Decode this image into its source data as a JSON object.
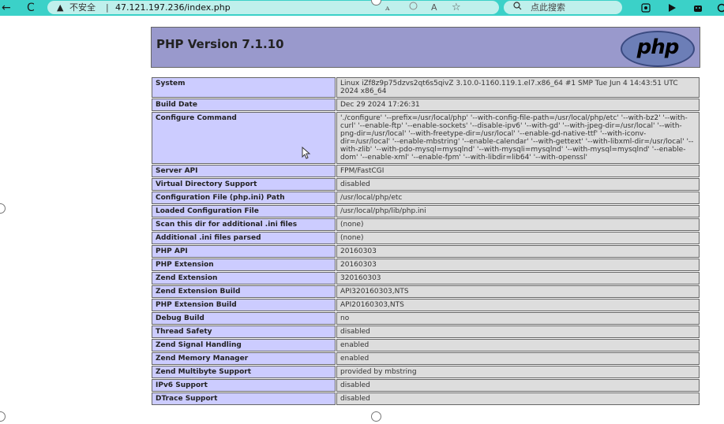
{
  "browser": {
    "back_glyph": "←",
    "reload_glyph": "C",
    "warning_glyph": "▲",
    "security_label": "不安全",
    "separator": "|",
    "url": "47.121.197.236/index.php",
    "read_aloud": "ꭺ",
    "immersive_glyph": "A",
    "favorite_glyph": "☆",
    "search_placeholder": "点此搜索",
    "tool_icons": [
      "screenshot-icon",
      "play-icon",
      "extension-icon"
    ]
  },
  "phpinfo": {
    "title": "PHP Version 7.1.10",
    "logo_text": "php",
    "rows": [
      {
        "key": "System",
        "value": "Linux iZf8z9p75dzvs2qt6s5qivZ 3.10.0-1160.119.1.el7.x86_64 #1 SMP Tue Jun 4 14:43:51 UTC 2024 x86_64"
      },
      {
        "key": "Build Date",
        "value": "Dec 29 2024 17:26:31"
      },
      {
        "key": "Configure Command",
        "value": "'./configure' '--prefix=/usr/local/php' '--with-config-file-path=/usr/local/php/etc' '--with-bz2' '--with-curl' '--enable-ftp' '--enable-sockets' '--disable-ipv6' '--with-gd' '--with-jpeg-dir=/usr/local' '--with-png-dir=/usr/local' '--with-freetype-dir=/usr/local' '--enable-gd-native-ttf' '--with-iconv-dir=/usr/local' '--enable-mbstring' '--enable-calendar' '--with-gettext' '--with-libxml-dir=/usr/local' '--with-zlib' '--with-pdo-mysql=mysqlnd' '--with-mysqli=mysqlnd' '--with-mysql=mysqlnd' '--enable-dom' '--enable-xml' '--enable-fpm' '--with-libdir=lib64' '--with-openssl'"
      },
      {
        "key": "Server API",
        "value": "FPM/FastCGI"
      },
      {
        "key": "Virtual Directory Support",
        "value": "disabled"
      },
      {
        "key": "Configuration File (php.ini) Path",
        "value": "/usr/local/php/etc"
      },
      {
        "key": "Loaded Configuration File",
        "value": "/usr/local/php/lib/php.ini"
      },
      {
        "key": "Scan this dir for additional .ini files",
        "value": "(none)"
      },
      {
        "key": "Additional .ini files parsed",
        "value": "(none)"
      },
      {
        "key": "PHP API",
        "value": "20160303"
      },
      {
        "key": "PHP Extension",
        "value": "20160303"
      },
      {
        "key": "Zend Extension",
        "value": "320160303"
      },
      {
        "key": "Zend Extension Build",
        "value": "API320160303,NTS"
      },
      {
        "key": "PHP Extension Build",
        "value": "API20160303,NTS"
      },
      {
        "key": "Debug Build",
        "value": "no"
      },
      {
        "key": "Thread Safety",
        "value": "disabled"
      },
      {
        "key": "Zend Signal Handling",
        "value": "enabled"
      },
      {
        "key": "Zend Memory Manager",
        "value": "enabled"
      },
      {
        "key": "Zend Multibyte Support",
        "value": "provided by mbstring"
      },
      {
        "key": "IPv6 Support",
        "value": "disabled"
      },
      {
        "key": "DTrace Support",
        "value": "disabled"
      }
    ]
  },
  "colors": {
    "browser_bar": "#3bd1c8",
    "header_bg": "#9999cc",
    "key_bg": "#ccccff",
    "value_bg": "#dddddd"
  }
}
